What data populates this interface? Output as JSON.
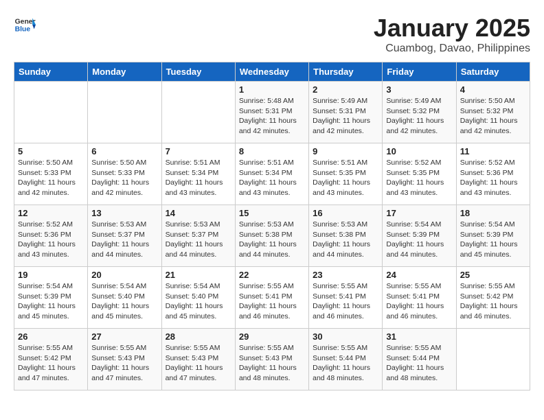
{
  "header": {
    "logo_general": "General",
    "logo_blue": "Blue",
    "month_title": "January 2025",
    "location": "Cuambog, Davao, Philippines"
  },
  "days_of_week": [
    "Sunday",
    "Monday",
    "Tuesday",
    "Wednesday",
    "Thursday",
    "Friday",
    "Saturday"
  ],
  "weeks": [
    [
      {
        "day": "",
        "info": ""
      },
      {
        "day": "",
        "info": ""
      },
      {
        "day": "",
        "info": ""
      },
      {
        "day": "1",
        "info": "Sunrise: 5:48 AM\nSunset: 5:31 PM\nDaylight: 11 hours\nand 42 minutes."
      },
      {
        "day": "2",
        "info": "Sunrise: 5:49 AM\nSunset: 5:31 PM\nDaylight: 11 hours\nand 42 minutes."
      },
      {
        "day": "3",
        "info": "Sunrise: 5:49 AM\nSunset: 5:32 PM\nDaylight: 11 hours\nand 42 minutes."
      },
      {
        "day": "4",
        "info": "Sunrise: 5:50 AM\nSunset: 5:32 PM\nDaylight: 11 hours\nand 42 minutes."
      }
    ],
    [
      {
        "day": "5",
        "info": "Sunrise: 5:50 AM\nSunset: 5:33 PM\nDaylight: 11 hours\nand 42 minutes."
      },
      {
        "day": "6",
        "info": "Sunrise: 5:50 AM\nSunset: 5:33 PM\nDaylight: 11 hours\nand 42 minutes."
      },
      {
        "day": "7",
        "info": "Sunrise: 5:51 AM\nSunset: 5:34 PM\nDaylight: 11 hours\nand 43 minutes."
      },
      {
        "day": "8",
        "info": "Sunrise: 5:51 AM\nSunset: 5:34 PM\nDaylight: 11 hours\nand 43 minutes."
      },
      {
        "day": "9",
        "info": "Sunrise: 5:51 AM\nSunset: 5:35 PM\nDaylight: 11 hours\nand 43 minutes."
      },
      {
        "day": "10",
        "info": "Sunrise: 5:52 AM\nSunset: 5:35 PM\nDaylight: 11 hours\nand 43 minutes."
      },
      {
        "day": "11",
        "info": "Sunrise: 5:52 AM\nSunset: 5:36 PM\nDaylight: 11 hours\nand 43 minutes."
      }
    ],
    [
      {
        "day": "12",
        "info": "Sunrise: 5:52 AM\nSunset: 5:36 PM\nDaylight: 11 hours\nand 43 minutes."
      },
      {
        "day": "13",
        "info": "Sunrise: 5:53 AM\nSunset: 5:37 PM\nDaylight: 11 hours\nand 44 minutes."
      },
      {
        "day": "14",
        "info": "Sunrise: 5:53 AM\nSunset: 5:37 PM\nDaylight: 11 hours\nand 44 minutes."
      },
      {
        "day": "15",
        "info": "Sunrise: 5:53 AM\nSunset: 5:38 PM\nDaylight: 11 hours\nand 44 minutes."
      },
      {
        "day": "16",
        "info": "Sunrise: 5:53 AM\nSunset: 5:38 PM\nDaylight: 11 hours\nand 44 minutes."
      },
      {
        "day": "17",
        "info": "Sunrise: 5:54 AM\nSunset: 5:39 PM\nDaylight: 11 hours\nand 44 minutes."
      },
      {
        "day": "18",
        "info": "Sunrise: 5:54 AM\nSunset: 5:39 PM\nDaylight: 11 hours\nand 45 minutes."
      }
    ],
    [
      {
        "day": "19",
        "info": "Sunrise: 5:54 AM\nSunset: 5:39 PM\nDaylight: 11 hours\nand 45 minutes."
      },
      {
        "day": "20",
        "info": "Sunrise: 5:54 AM\nSunset: 5:40 PM\nDaylight: 11 hours\nand 45 minutes."
      },
      {
        "day": "21",
        "info": "Sunrise: 5:54 AM\nSunset: 5:40 PM\nDaylight: 11 hours\nand 45 minutes."
      },
      {
        "day": "22",
        "info": "Sunrise: 5:55 AM\nSunset: 5:41 PM\nDaylight: 11 hours\nand 46 minutes."
      },
      {
        "day": "23",
        "info": "Sunrise: 5:55 AM\nSunset: 5:41 PM\nDaylight: 11 hours\nand 46 minutes."
      },
      {
        "day": "24",
        "info": "Sunrise: 5:55 AM\nSunset: 5:41 PM\nDaylight: 11 hours\nand 46 minutes."
      },
      {
        "day": "25",
        "info": "Sunrise: 5:55 AM\nSunset: 5:42 PM\nDaylight: 11 hours\nand 46 minutes."
      }
    ],
    [
      {
        "day": "26",
        "info": "Sunrise: 5:55 AM\nSunset: 5:42 PM\nDaylight: 11 hours\nand 47 minutes."
      },
      {
        "day": "27",
        "info": "Sunrise: 5:55 AM\nSunset: 5:43 PM\nDaylight: 11 hours\nand 47 minutes."
      },
      {
        "day": "28",
        "info": "Sunrise: 5:55 AM\nSunset: 5:43 PM\nDaylight: 11 hours\nand 47 minutes."
      },
      {
        "day": "29",
        "info": "Sunrise: 5:55 AM\nSunset: 5:43 PM\nDaylight: 11 hours\nand 48 minutes."
      },
      {
        "day": "30",
        "info": "Sunrise: 5:55 AM\nSunset: 5:44 PM\nDaylight: 11 hours\nand 48 minutes."
      },
      {
        "day": "31",
        "info": "Sunrise: 5:55 AM\nSunset: 5:44 PM\nDaylight: 11 hours\nand 48 minutes."
      },
      {
        "day": "",
        "info": ""
      }
    ]
  ]
}
